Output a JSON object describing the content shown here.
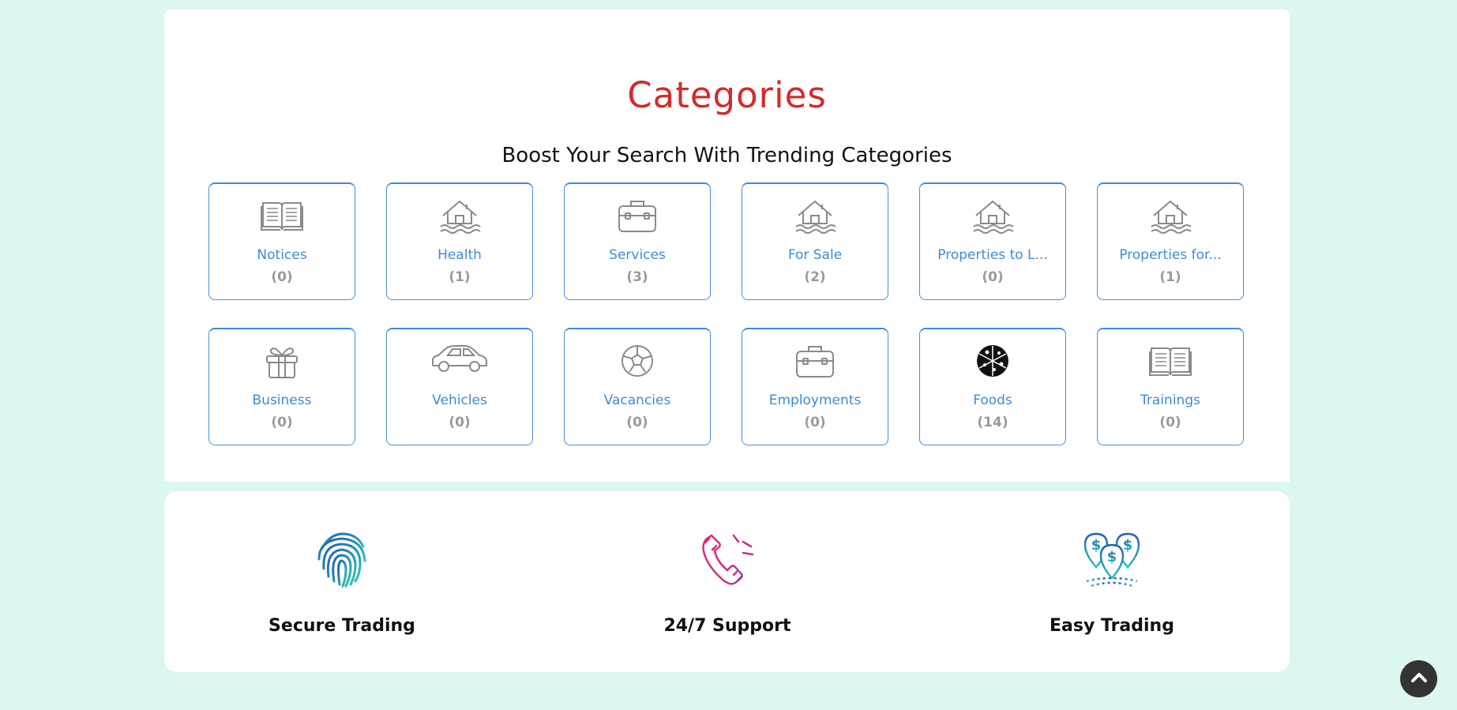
{
  "header": {
    "title": "Categories",
    "subtitle": "Boost Your Search With Trending Categories"
  },
  "categories": [
    {
      "label": "Notices",
      "count": "(0)",
      "icon": "book-icon"
    },
    {
      "label": "Health",
      "count": "(1)",
      "icon": "house-flood-icon"
    },
    {
      "label": "Services",
      "count": "(3)",
      "icon": "briefcase-icon"
    },
    {
      "label": "For Sale",
      "count": "(2)",
      "icon": "house-flood-icon"
    },
    {
      "label": "Properties to L...",
      "count": "(0)",
      "icon": "house-flood-icon"
    },
    {
      "label": "Properties for...",
      "count": "(1)",
      "icon": "house-flood-icon"
    },
    {
      "label": "Business",
      "count": "(0)",
      "icon": "gift-box-icon"
    },
    {
      "label": "Vehicles",
      "count": "(0)",
      "icon": "car-icon"
    },
    {
      "label": "Vacancies",
      "count": "(0)",
      "icon": "soccer-ball-icon"
    },
    {
      "label": "Employments",
      "count": "(0)",
      "icon": "briefcase-icon"
    },
    {
      "label": "Foods",
      "count": "(14)",
      "icon": "pizza-icon"
    },
    {
      "label": "Trainings",
      "count": "(0)",
      "icon": "book-icon"
    }
  ],
  "features": [
    {
      "label": "Secure Trading",
      "icon": "fingerprint-icon"
    },
    {
      "label": "24/7 Support",
      "icon": "phone-ringing-icon"
    },
    {
      "label": "Easy Trading",
      "icon": "money-pins-icon"
    }
  ],
  "colors": {
    "background": "#dcf6f2",
    "title": "#d12b2b",
    "accent": "#3d8bd6"
  },
  "scroll_to_top": {
    "icon": "chevron-up-icon"
  }
}
